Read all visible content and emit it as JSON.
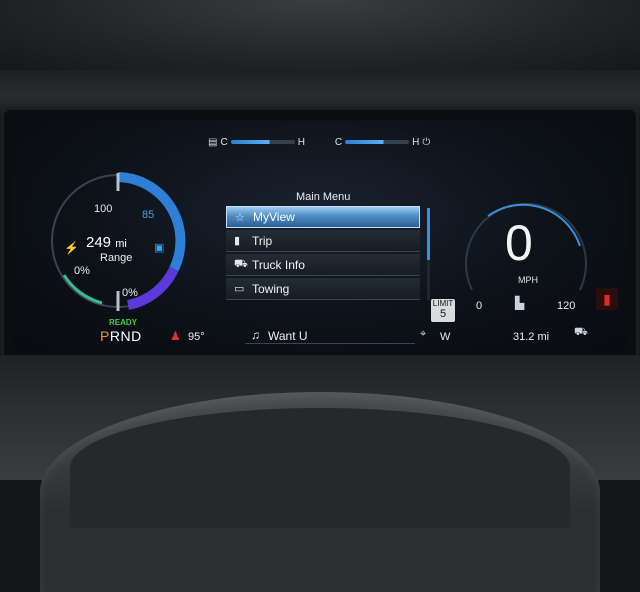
{
  "top_gauges": {
    "left": {
      "low": "C",
      "high": "H",
      "icon": "battery-temp-icon"
    },
    "right": {
      "low": "C",
      "high": "H",
      "icon": "coolant-temp-icon"
    }
  },
  "battery": {
    "range_value": "249",
    "range_unit": "mi",
    "range_label": "Range",
    "scale_top": "100",
    "charge_target": "85",
    "left_percent": "0%",
    "bottom_percent": "0%"
  },
  "menu": {
    "title": "Main Menu",
    "items": [
      {
        "label": "MyView",
        "icon": "star-icon",
        "selected": true
      },
      {
        "label": "Trip",
        "icon": "fuel-pump-icon",
        "selected": false
      },
      {
        "label": "Truck Info",
        "icon": "truck-icon",
        "selected": false
      },
      {
        "label": "Towing",
        "icon": "trailer-icon",
        "selected": false
      }
    ]
  },
  "speedometer": {
    "speed": "0",
    "unit": "MPH",
    "min": "0",
    "max": "120"
  },
  "speed_limit": {
    "label": "LIMIT",
    "value": "5"
  },
  "status_bar": {
    "ready": "READY",
    "gear_selected": "P",
    "gear_rest": "RND",
    "outside_temp": "95°",
    "now_playing": "Want U",
    "heading": "W",
    "trip_distance": "31.2 mi"
  },
  "colors": {
    "accent": "#3aa0f0",
    "ready": "#3fd04a",
    "gear_selected": "#ff8a1c",
    "warning": "#e02a2a"
  }
}
